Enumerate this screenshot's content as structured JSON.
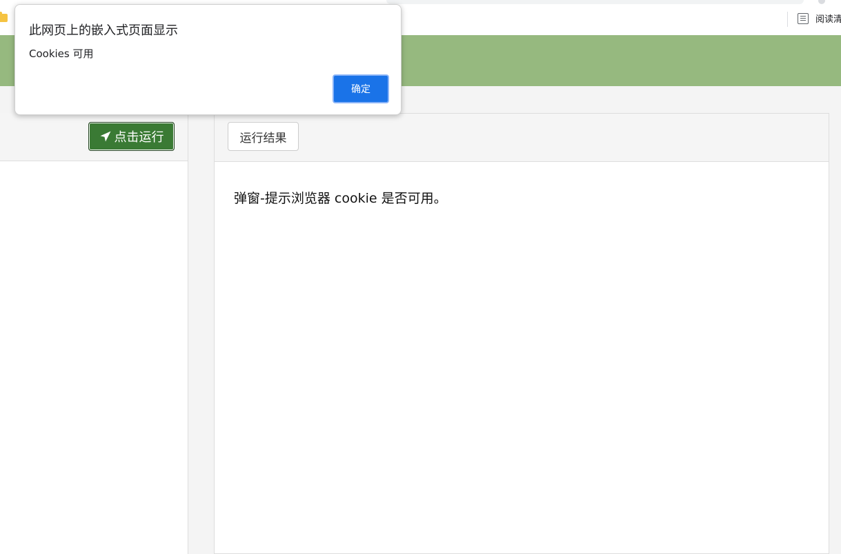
{
  "browser": {
    "reading_list_label": "阅读清"
  },
  "editor": {
    "run_button_label": "点击运行"
  },
  "result": {
    "tab_label": "运行结果",
    "content_text": "弹窗-提示浏览器 cookie 是否可用。"
  },
  "dialog": {
    "title": "此网页上的嵌入式页面显示",
    "message": "Cookies 可用",
    "ok_label": "确定"
  },
  "colors": {
    "header_green": "#96b97f",
    "run_button_green": "#3a7a34",
    "dialog_button_blue": "#1a73e8"
  },
  "icons": {
    "run_button": "paper-plane-icon",
    "bookmark": "folder-icon",
    "reading_list": "reading-list-icon"
  }
}
